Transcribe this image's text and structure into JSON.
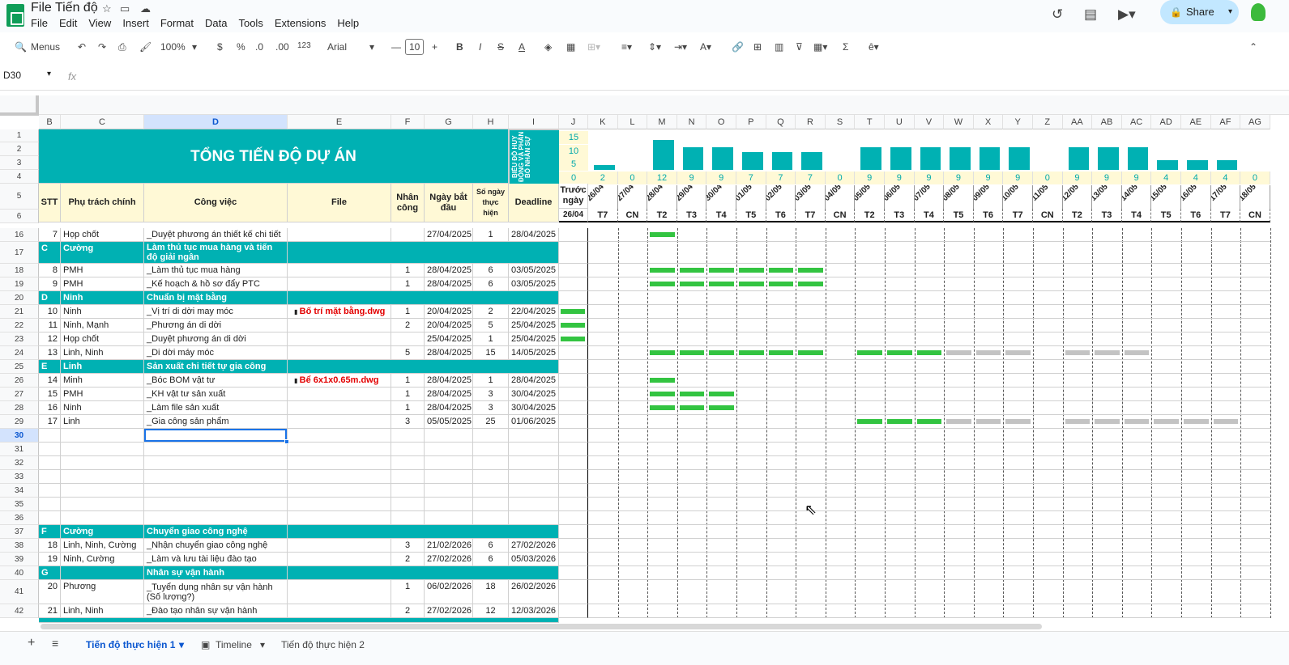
{
  "app": {
    "title": "File Tiến độ",
    "menus": [
      "File",
      "Edit",
      "View",
      "Insert",
      "Format",
      "Data",
      "Tools",
      "Extensions",
      "Help"
    ],
    "share": "Share"
  },
  "toolbar": {
    "menus": "Menus",
    "zoom": "100%",
    "currency": "$",
    "percent": "%",
    "dec_dec": ".0",
    "dec_inc": ".00",
    "numfmt": "123",
    "font": "Arial",
    "font_size": "10"
  },
  "formula": {
    "namebox": "D30",
    "fx": "fx"
  },
  "columns": [
    "B",
    "C",
    "D",
    "E",
    "F",
    "G",
    "H",
    "I",
    "J",
    "K",
    "L",
    "M",
    "N",
    "O",
    "P",
    "Q",
    "R",
    "S",
    "T",
    "U",
    "V",
    "W",
    "X",
    "Y",
    "Z",
    "AA",
    "AB",
    "AC",
    "AD",
    "AE",
    "AF",
    "AG"
  ],
  "header": {
    "title": "TỔNG TIẾN ĐỘ DỰ ÁN",
    "vertical_label": "BIỂU ĐỒ HUY ĐỘNG VÀ PHÂN BỔ NHÂN SỰ",
    "stt": "STT",
    "phu_trach": "Phụ trách chính",
    "cong_viec": "Công việc",
    "file": "File",
    "nhan_cong": "Nhân công",
    "ngay_bat_dau": "Ngày bắt đầu",
    "so_ngay": "Số ngày thực hiện",
    "deadline": "Deadline",
    "truoc_ngay": "Trước ngày",
    "truoc_date": "26/04"
  },
  "chart_axis": [
    "15",
    "10",
    "5",
    "0"
  ],
  "chart_values": [
    "2",
    "0",
    "12",
    "9",
    "9",
    "7",
    "7",
    "7",
    "0",
    "9",
    "9",
    "9",
    "9",
    "9",
    "9",
    "0",
    "9",
    "9",
    "9",
    "4",
    "4",
    "4",
    "0"
  ],
  "dates": [
    "26/04",
    "27/04",
    "28/04",
    "29/04",
    "30/04",
    "01/05",
    "02/05",
    "03/05",
    "04/05",
    "05/05",
    "06/05",
    "07/05",
    "08/05",
    "09/05",
    "10/05",
    "11/05",
    "12/05",
    "13/05",
    "14/05",
    "15/05",
    "16/05",
    "17/05",
    "18/05"
  ],
  "days": [
    "T7",
    "CN",
    "T2",
    "T3",
    "T4",
    "T5",
    "T6",
    "T7",
    "CN",
    "T2",
    "T3",
    "T4",
    "T5",
    "T6",
    "T7",
    "CN",
    "T2",
    "T3",
    "T4",
    "T5",
    "T6",
    "T7",
    "CN"
  ],
  "rows": [
    {
      "n": "16",
      "stt": "7",
      "who": "Họp chốt",
      "task": "_Duyệt phương án thiết kế chi tiết",
      "file": "",
      "nc": "",
      "start": "27/04/2025",
      "days": "1",
      "dl": "28/04/2025"
    },
    {
      "n": "17",
      "stt": "C",
      "who": "Cường",
      "task": "Làm thủ tục mua hàng và tiến độ giải ngân",
      "section": true
    },
    {
      "n": "18",
      "stt": "8",
      "who": "PMH",
      "task": "_Làm thủ tục mua hàng",
      "file": "",
      "nc": "1",
      "start": "28/04/2025",
      "days": "6",
      "dl": "03/05/2025"
    },
    {
      "n": "19",
      "stt": "9",
      "who": "PMH",
      "task": "_Kế hoạch & hồ sơ đẩy PTC",
      "file": "",
      "nc": "1",
      "start": "28/04/2025",
      "days": "6",
      "dl": "03/05/2025"
    },
    {
      "n": "20",
      "stt": "D",
      "who": "Ninh",
      "task": "Chuẩn bị mặt bằng",
      "section": true
    },
    {
      "n": "21",
      "stt": "10",
      "who": "Ninh",
      "task": "_Vị trí di dời may móc",
      "file": "Bố trí mặt bằng.dwg",
      "nc": "1",
      "start": "20/04/2025",
      "days": "2",
      "dl": "22/04/2025"
    },
    {
      "n": "22",
      "stt": "11",
      "who": "Ninh, Mạnh",
      "task": "_Phương án di dời",
      "file": "",
      "nc": "2",
      "start": "20/04/2025",
      "days": "5",
      "dl": "25/04/2025"
    },
    {
      "n": "23",
      "stt": "12",
      "who": "Họp chốt",
      "task": "_Duyệt phương án di dời",
      "file": "",
      "nc": "",
      "start": "25/04/2025",
      "days": "1",
      "dl": "25/04/2025"
    },
    {
      "n": "24",
      "stt": "13",
      "who": "Linh, Ninh",
      "task": "_Di dời máy móc",
      "file": "",
      "nc": "5",
      "start": "28/04/2025",
      "days": "15",
      "dl": "14/05/2025"
    },
    {
      "n": "25",
      "stt": "E",
      "who": "Linh",
      "task": "Sản xuất chi tiết tự gia công",
      "section": true
    },
    {
      "n": "26",
      "stt": "14",
      "who": "Minh",
      "task": "_Bóc BOM vật tư",
      "file": "Bể 6x1x0.65m.dwg",
      "nc": "1",
      "start": "28/04/2025",
      "days": "1",
      "dl": "28/04/2025"
    },
    {
      "n": "27",
      "stt": "15",
      "who": "PMH",
      "task": "_KH vật tư sản xuất",
      "file": "",
      "nc": "1",
      "start": "28/04/2025",
      "days": "3",
      "dl": "30/04/2025"
    },
    {
      "n": "28",
      "stt": "16",
      "who": "Ninh",
      "task": "_Làm file sản xuất",
      "file": "",
      "nc": "1",
      "start": "28/04/2025",
      "days": "3",
      "dl": "30/04/2025"
    },
    {
      "n": "29",
      "stt": "17",
      "who": "Linh",
      "task": "_Gia công sản phẩm",
      "file": "",
      "nc": "3",
      "start": "05/05/2025",
      "days": "25",
      "dl": "01/06/2025"
    },
    {
      "n": "30"
    },
    {
      "n": "31"
    },
    {
      "n": "32"
    },
    {
      "n": "33"
    },
    {
      "n": "34"
    },
    {
      "n": "35"
    },
    {
      "n": "36"
    },
    {
      "n": "37",
      "stt": "F",
      "who": "Cường",
      "task": "Chuyển giao công nghệ",
      "section": true
    },
    {
      "n": "38",
      "stt": "18",
      "who": "Linh, Ninh, Cường",
      "task": "_Nhận chuyển giao công nghệ",
      "file": "",
      "nc": "3",
      "start": "21/02/2026",
      "days": "6",
      "dl": "27/02/2026"
    },
    {
      "n": "39",
      "stt": "19",
      "who": "Ninh, Cường",
      "task": "_Làm và lưu tài liệu đào tạo",
      "file": "",
      "nc": "2",
      "start": "27/02/2026",
      "days": "6",
      "dl": "05/03/2026"
    },
    {
      "n": "40",
      "stt": "G",
      "who": "",
      "task": "Nhân sự vận hành",
      "section": true
    },
    {
      "n": "41",
      "stt": "20",
      "who": "Phương",
      "task": "_Tuyển dụng nhân sự vận hành (Số lượng?)",
      "file": "",
      "nc": "1",
      "start": "06/02/2026",
      "days": "18",
      "dl": "26/02/2026"
    },
    {
      "n": "42",
      "stt": "21",
      "who": "Linh, Ninh",
      "task": "_Đào tạo nhân sự vận hành",
      "file": "",
      "nc": "2",
      "start": "27/02/2026",
      "days": "12",
      "dl": "12/03/2026"
    }
  ],
  "sheets": [
    "Tiến độ thực hiện 1",
    "Timeline",
    "Tiến độ thực hiện 2"
  ],
  "colors": {
    "teal": "#00b1b3",
    "header_bg": "#fff9d6",
    "bar_done": "#33c441",
    "bar_plan": "#c3c3c3"
  }
}
